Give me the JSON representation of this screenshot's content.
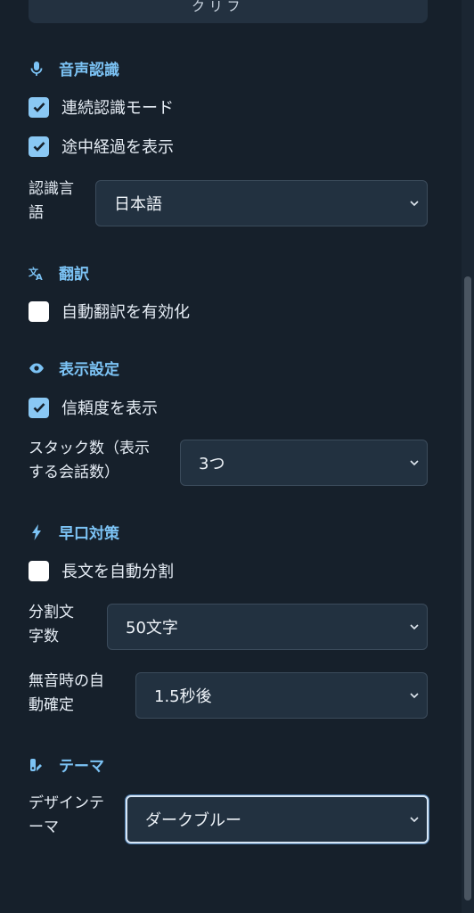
{
  "top_button": {
    "label_fragment": "ク リ フ"
  },
  "sections": {
    "speech": {
      "title": "音声認識",
      "continuous_label": "連続認識モード",
      "interim_label": "途中経過を表示",
      "language_label_line1": "認識言",
      "language_label_line2": "語",
      "language_value": "日本語"
    },
    "translation": {
      "title": "翻訳",
      "auto_translate_label": "自動翻訳を有効化"
    },
    "display": {
      "title": "表示設定",
      "confidence_label": "信頼度を表示",
      "stack_label_line1": "スタック数（表示",
      "stack_label_line2": "する会話数）",
      "stack_value": "3つ"
    },
    "fast_speech": {
      "title": "早口対策",
      "auto_split_label": "長文を自動分割",
      "split_label_line1": "分割文",
      "split_label_line2": "字数",
      "split_value": "50文字",
      "silence_label_line1": "無音時の自",
      "silence_label_line2": "動確定",
      "silence_value": "1.5秒後"
    },
    "theme": {
      "title": "テーマ",
      "design_label_line1": "デザインテ",
      "design_label_line2": "ーマ",
      "design_value": "ダークブルー"
    }
  },
  "checkbox_states": {
    "continuous": true,
    "interim": true,
    "auto_translate": false,
    "confidence": true,
    "auto_split": false
  },
  "colors": {
    "accent": "#7cc3f5",
    "checkbox_on": "#8ac8f4",
    "background": "#16202b",
    "select_bg": "#223140"
  }
}
